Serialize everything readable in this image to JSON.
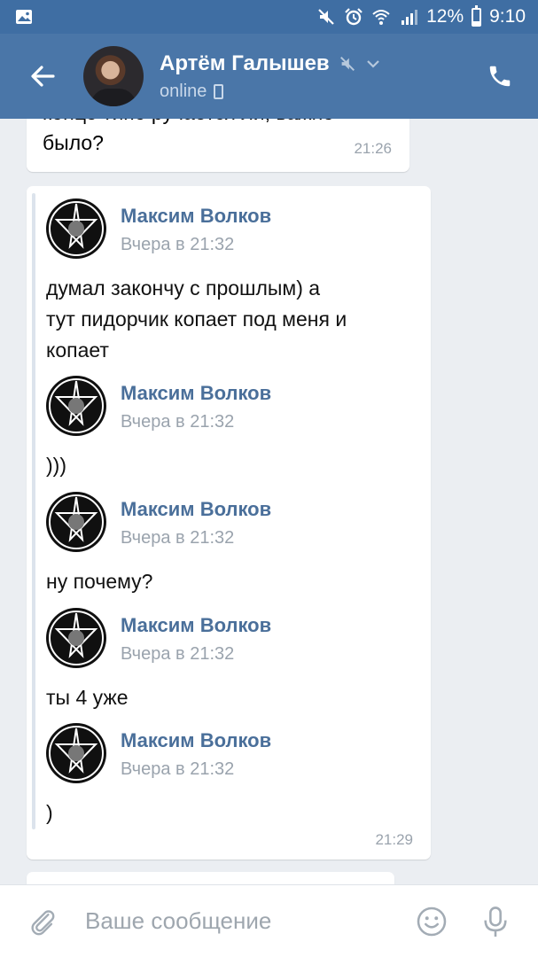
{
  "status_bar": {
    "battery_level": "12%",
    "time": "9:10",
    "icons": [
      "gallery-icon",
      "mute-icon",
      "alarm-icon",
      "wifi-icon",
      "signal-icon",
      "battery-icon"
    ]
  },
  "header": {
    "name": "Артём Галышев",
    "status": "online",
    "icons": [
      "back-arrow-icon",
      "mute-icon",
      "chevron-down-icon",
      "mobile-icon",
      "phone-icon"
    ]
  },
  "messages": {
    "previous": {
      "text_line1": "конце типо ручается ли, важно",
      "text_line2": "было?",
      "time": "21:26"
    },
    "forwarded": {
      "time": "21:29",
      "items": [
        {
          "sender": "Максим Волков",
          "date": "Вчера в 21:32",
          "text": [
            "думал закончу с прошлым) а",
            "тут пидорчик копает под меня и",
            "копает"
          ]
        },
        {
          "sender": "Максим Волков",
          "date": "Вчера в 21:32",
          "text": ")))"
        },
        {
          "sender": "Максим Волков",
          "date": "Вчера в 21:32",
          "text": "ну почему?"
        },
        {
          "sender": "Максим Волков",
          "date": "Вчера в 21:32",
          "text": "ты 4 уже"
        },
        {
          "sender": "Максим Волков",
          "date": "Вчера в 21:32",
          "text": ")"
        }
      ]
    }
  },
  "input": {
    "placeholder": "Ваше сообщение",
    "value": ""
  },
  "colors": {
    "status_bar": "#3f6ea3",
    "header": "#4a76a8",
    "chat_background": "#ebeef2",
    "sender_name": "#4a6f9a",
    "meta_gray": "#9aa3ad"
  }
}
